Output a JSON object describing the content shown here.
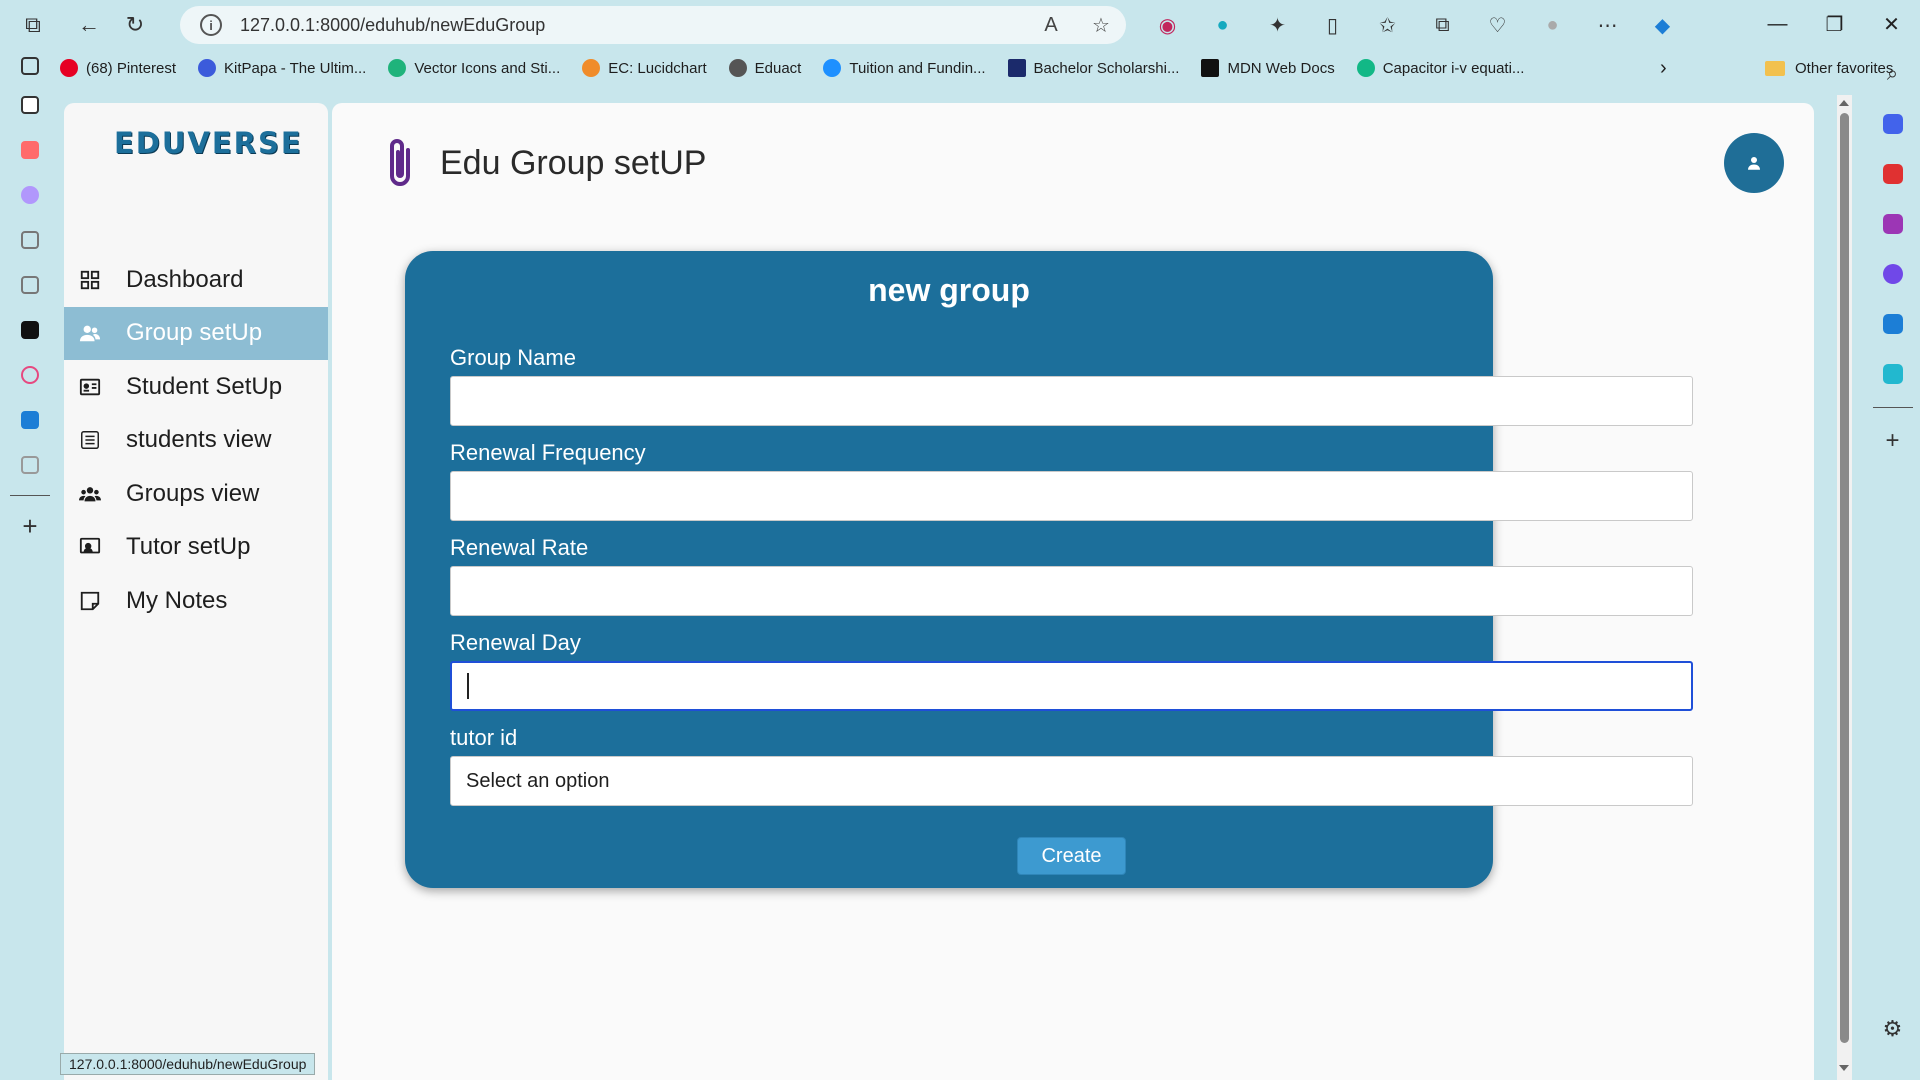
{
  "browser": {
    "url": "127.0.0.1:8000/eduhub/newEduGroup",
    "status_url": "127.0.0.1:8000/eduhub/newEduGroup",
    "bookmarks": [
      {
        "label": "(68) Pinterest",
        "color": "#e60023"
      },
      {
        "label": "KitPapa - The Ultim...",
        "color": "#3b5bdb"
      },
      {
        "label": "Vector Icons and Sti...",
        "color": "#1fb37b"
      },
      {
        "label": "EC: Lucidchart",
        "color": "#f08c2a"
      },
      {
        "label": "Eduact",
        "color": "#555555"
      },
      {
        "label": "Tuition and Fundin...",
        "color": "#1e90ff"
      },
      {
        "label": "Bachelor Scholarshi...",
        "color": "#1b2a6b"
      },
      {
        "label": "MDN Web Docs",
        "color": "#111111"
      },
      {
        "label": "Capacitor i-v equati...",
        "color": "#12b886"
      }
    ],
    "other_favorites": "Other favorites"
  },
  "app": {
    "logo": "EDUVERSE",
    "page_title": "Edu Group setUP",
    "nav": [
      {
        "label": "Dashboard",
        "icon": "dashboard-icon"
      },
      {
        "label": "Group setUp",
        "icon": "users-icon",
        "active": true
      },
      {
        "label": "Student SetUp",
        "icon": "id-card-icon"
      },
      {
        "label": "students view",
        "icon": "list-icon"
      },
      {
        "label": "Groups view",
        "icon": "group-icon"
      },
      {
        "label": "Tutor setUp",
        "icon": "tutor-icon"
      },
      {
        "label": "My Notes",
        "icon": "note-icon"
      }
    ]
  },
  "form": {
    "title": "new group",
    "fields": [
      {
        "label": "Group Name",
        "value": ""
      },
      {
        "label": "Renewal Frequency",
        "value": ""
      },
      {
        "label": "Renewal Rate",
        "value": ""
      },
      {
        "label": "Renewal Day",
        "value": "",
        "focused": true
      },
      {
        "label": "tutor id",
        "value": "Select an option"
      }
    ],
    "submit_label": "Create"
  },
  "colors": {
    "primary": "#1c6f9b",
    "active_nav": "#8dbdd3",
    "button": "#3d9ad0"
  }
}
